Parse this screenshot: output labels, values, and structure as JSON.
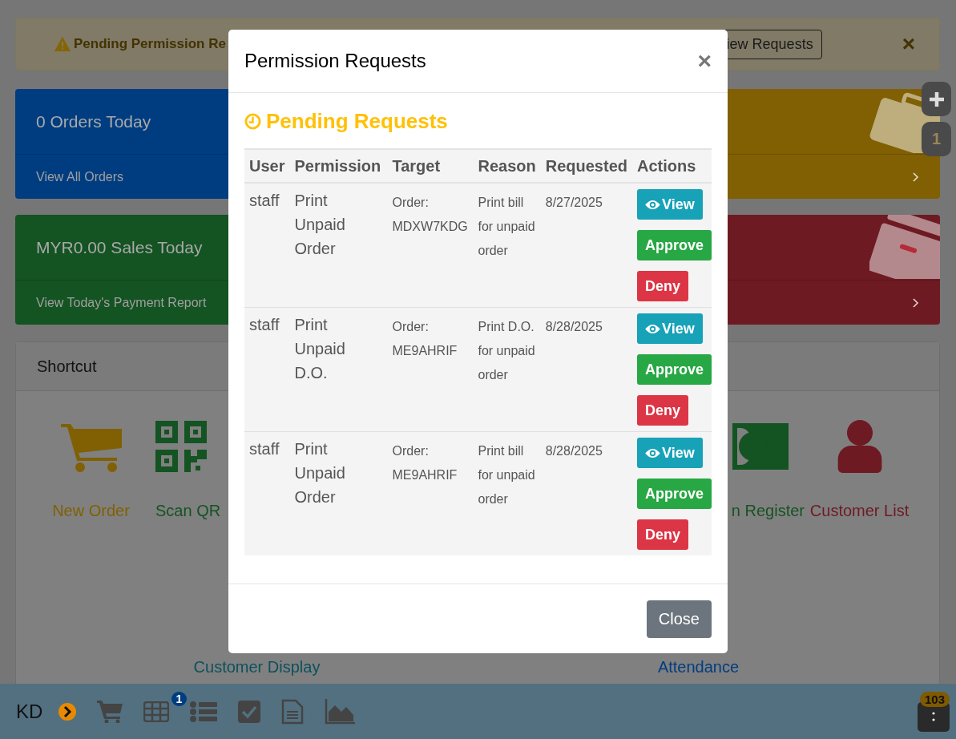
{
  "banner": {
    "title": "Pending Permission Re",
    "button": "iew Requests",
    "close": "×"
  },
  "cards": [
    {
      "title": "0 Orders Today",
      "link": "View All Orders",
      "color": "#003d80"
    },
    {
      "title": "MYR0.00 Sales Today",
      "link": "View Today's Payment Report",
      "color": "#145322"
    }
  ],
  "side_cards": [
    {
      "kind": "briefcase",
      "color": "#806003"
    },
    {
      "kind": "box",
      "color": "#6e1a22"
    }
  ],
  "float_buttons": [
    {
      "kind": "plus"
    },
    {
      "kind": "count",
      "label": "1"
    }
  ],
  "shortcut": {
    "title": "Shortcut",
    "items": [
      {
        "label": "New Order",
        "kind": "cart",
        "color": "#806003"
      },
      {
        "label": "Scan QR",
        "kind": "qr",
        "color": "#145322"
      },
      {
        "label": "n Register",
        "kind": "cash",
        "color": "#145322"
      },
      {
        "label": "Customer List",
        "kind": "person",
        "color": "#6e1a22"
      }
    ],
    "items_row2": [
      {
        "label": "Customer Display",
        "color": "#0c515c"
      },
      {
        "label": "Attendance",
        "color": "#003d80"
      }
    ]
  },
  "modal": {
    "title": "Permission Requests",
    "close": "×",
    "section": "Pending Requests",
    "columns": [
      "User",
      "Permission",
      "Target",
      "Reason",
      "Requested",
      "Actions"
    ],
    "rows": [
      {
        "user": "staff",
        "permission": "Print Unpaid Order",
        "target": "Order: MDXW7KDG",
        "reason": "Print bill for unpaid order",
        "requested": "8/27/2025",
        "actions": [
          {
            "kind": "view",
            "label": "View"
          },
          {
            "kind": "approve",
            "label": "Approve"
          },
          {
            "kind": "deny",
            "label": "Deny"
          }
        ]
      },
      {
        "user": "staff",
        "permission": "Print Unpaid D.O.",
        "target": "Order: ME9AHRIF",
        "reason": "Print D.O. for unpaid order",
        "requested": "8/28/2025",
        "actions": [
          {
            "kind": "view",
            "label": "View"
          },
          {
            "kind": "approve",
            "label": "Approve"
          },
          {
            "kind": "deny",
            "label": "Deny"
          }
        ]
      },
      {
        "user": "staff",
        "permission": "Print Unpaid Order",
        "target": "Order: ME9AHRIF",
        "reason": "Print bill for unpaid order",
        "requested": "8/28/2025",
        "actions": [
          {
            "kind": "view",
            "label": "View"
          },
          {
            "kind": "approve",
            "label": "Approve"
          },
          {
            "kind": "deny",
            "label": "Deny"
          }
        ]
      }
    ],
    "footer_button": "Close"
  },
  "bottom_bar": {
    "user": "KD",
    "icons": [
      {
        "kind": "chevron"
      },
      {
        "kind": "cart"
      },
      {
        "kind": "table",
        "badge": "1"
      },
      {
        "kind": "list"
      },
      {
        "kind": "check"
      },
      {
        "kind": "document"
      },
      {
        "kind": "chart"
      }
    ],
    "menu_badge": "103"
  }
}
